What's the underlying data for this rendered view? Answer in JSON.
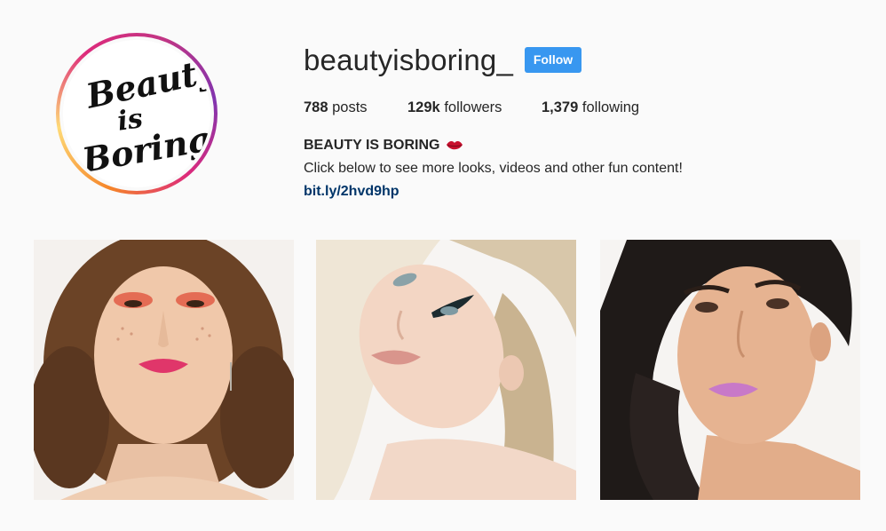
{
  "profile": {
    "username": "beautyisboring_",
    "follow_label": "Follow",
    "avatar_logo_lines": [
      "Beauty",
      "is",
      "Boring"
    ]
  },
  "stats": {
    "posts_count": "788",
    "posts_label": "posts",
    "followers_count": "129k",
    "followers_label": "followers",
    "following_count": "1,379",
    "following_label": "following"
  },
  "bio": {
    "name": "BEAUTY IS BORING",
    "name_emoji_icon": "kiss-lips-icon",
    "text": "Click below to see more looks, videos and other fun content!",
    "link": "bit.ly/2hvd9hp"
  },
  "colors": {
    "follow_button": "#3897f0",
    "link": "#003569",
    "background": "#fafafa",
    "text": "#262626"
  },
  "posts": [
    {
      "icon": "portrait-photo-icon"
    },
    {
      "icon": "portrait-photo-icon"
    },
    {
      "icon": "portrait-photo-icon"
    }
  ]
}
